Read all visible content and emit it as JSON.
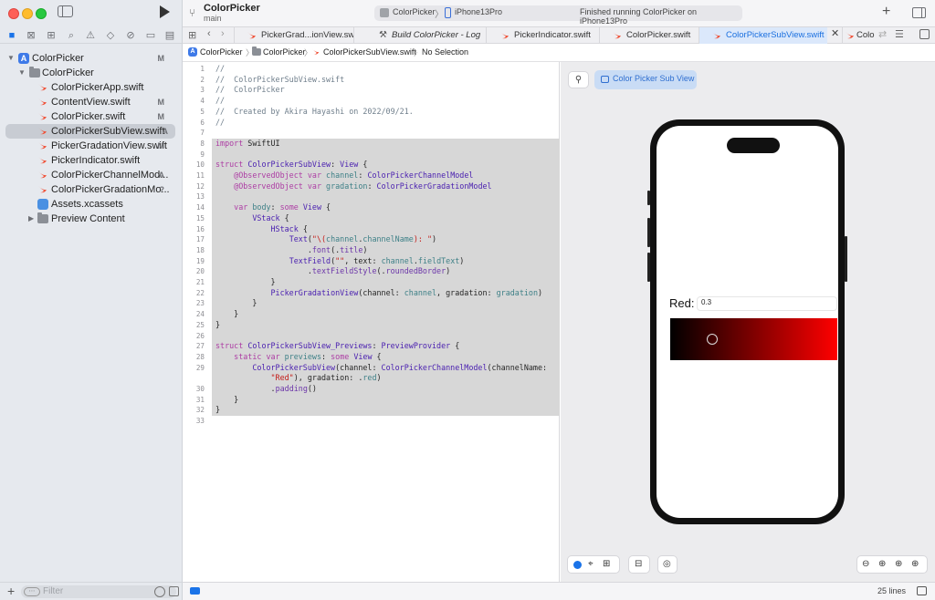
{
  "window": {
    "project_title": "ColorPicker",
    "branch": "main"
  },
  "activity": {
    "scheme": "ColorPicker",
    "separator": "〉",
    "device": "iPhone13Pro",
    "status": "Finished running ColorPicker on iPhone13Pro"
  },
  "navigator": {
    "tree": [
      {
        "label": "ColorPicker",
        "status": "M",
        "kind": "project"
      },
      {
        "label": "ColorPicker",
        "status": "",
        "kind": "folder"
      },
      {
        "label": "ColorPickerApp.swift",
        "status": "",
        "kind": "swift"
      },
      {
        "label": "ContentView.swift",
        "status": "M",
        "kind": "swift"
      },
      {
        "label": "ColorPicker.swift",
        "status": "M",
        "kind": "swift"
      },
      {
        "label": "ColorPickerSubView.swift",
        "status": "A",
        "kind": "swift",
        "selected": true
      },
      {
        "label": "PickerGradationView.swift",
        "status": "M",
        "kind": "swift"
      },
      {
        "label": "PickerIndicator.swift",
        "status": "",
        "kind": "swift"
      },
      {
        "label": "ColorPickerChannelMod...",
        "status": "A",
        "kind": "swift"
      },
      {
        "label": "ColorPickerGradationMo...",
        "status": "?",
        "kind": "swift"
      },
      {
        "label": "Assets.xcassets",
        "status": "",
        "kind": "asset"
      },
      {
        "label": "Preview Content",
        "status": "",
        "kind": "folder"
      }
    ],
    "filter_placeholder": "Filter"
  },
  "tabs": [
    {
      "label": "PickerGrad...ionView.swift"
    },
    {
      "label": "Build ColorPicker - Log"
    },
    {
      "label": "PickerIndicator.swift"
    },
    {
      "label": "ColorPicker.swift"
    },
    {
      "label": "ColorPickerSubView.swift",
      "active": true
    },
    {
      "label": "Color"
    }
  ],
  "jumpbar": {
    "items": [
      "ColorPicker",
      "ColorPicker",
      "ColorPickerSubView.swift",
      "No Selection"
    ],
    "separator": "〉"
  },
  "code": {
    "line_numbers": [
      "1",
      "2",
      "3",
      "4",
      "5",
      "6",
      "7",
      "8",
      "9",
      "10",
      "11",
      "12",
      "13",
      "14",
      "15",
      "16",
      "17",
      "18",
      "19",
      "20",
      "21",
      "22",
      "23",
      "24",
      "25",
      "26",
      "27",
      "28",
      "29",
      "",
      "30",
      "31",
      "32",
      "33"
    ]
  },
  "preview": {
    "chip_label": "Color Picker Sub View",
    "channel_label": "Red:",
    "text_field_value": "0.3",
    "knob_position": 0.25,
    "gradient_colors": [
      "#000000",
      "#ff0000"
    ]
  },
  "status_bar": {
    "line_count": "25 lines"
  },
  "colors": {
    "accent": "#1a73e8",
    "selection_highlight": "#d7d7d7",
    "swift_icon": "#f05138"
  }
}
